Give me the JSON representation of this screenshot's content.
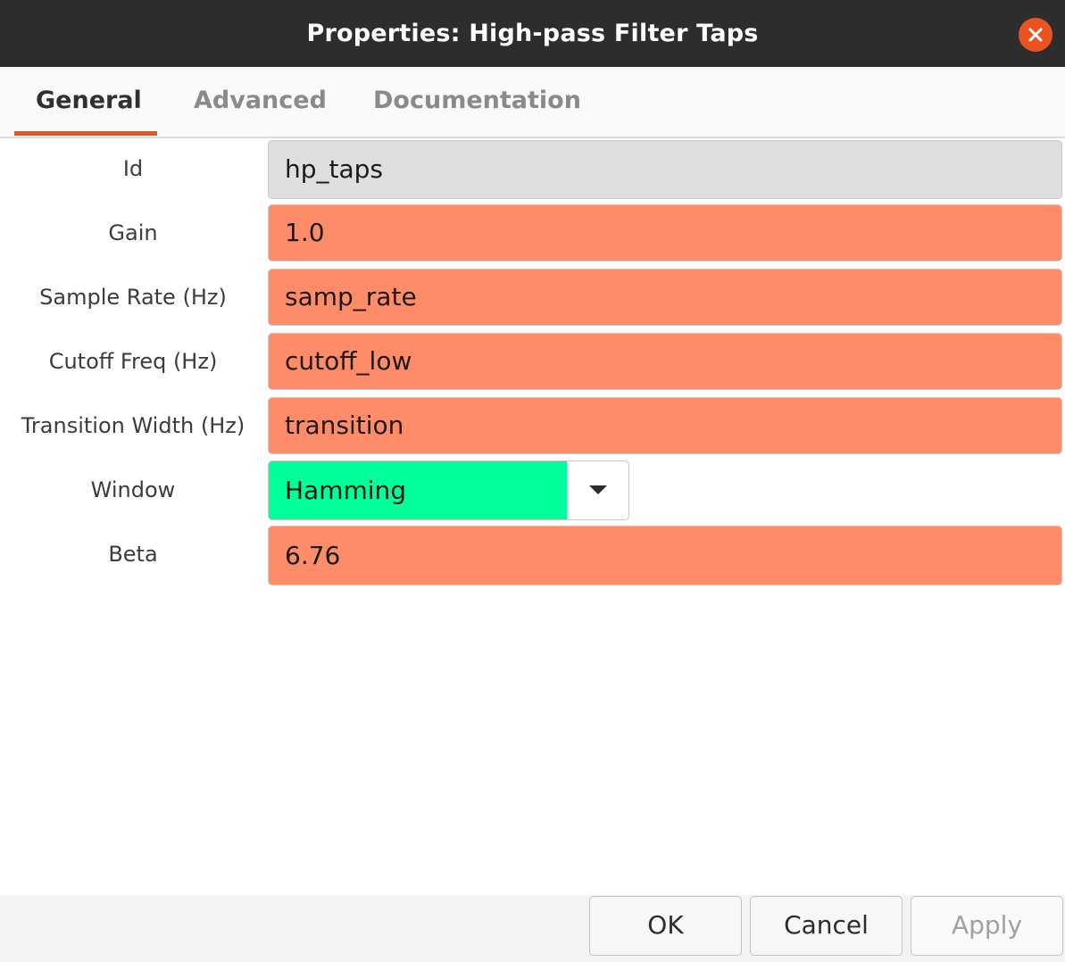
{
  "window": {
    "title": "Properties: High-pass Filter Taps"
  },
  "tabs": [
    {
      "label": "General",
      "active": true
    },
    {
      "label": "Advanced",
      "active": false
    },
    {
      "label": "Documentation",
      "active": false
    }
  ],
  "fields": {
    "id": {
      "label": "Id",
      "value": "hp_taps"
    },
    "gain": {
      "label": "Gain",
      "value": "1.0"
    },
    "sample_rate": {
      "label": "Sample Rate (Hz)",
      "value": "samp_rate"
    },
    "cutoff_freq": {
      "label": "Cutoff Freq (Hz)",
      "value": "cutoff_low"
    },
    "transition_width": {
      "label": "Transition Width (Hz)",
      "value": "transition"
    },
    "window": {
      "label": "Window",
      "value": "Hamming"
    },
    "beta": {
      "label": "Beta",
      "value": "6.76"
    }
  },
  "buttons": {
    "ok": "OK",
    "cancel": "Cancel",
    "apply": "Apply"
  },
  "colors": {
    "accent": "#e95420",
    "field_error": "#ff8c69",
    "field_readonly": "#dedede",
    "field_enum": "#00ff99",
    "titlebar": "#2d2d2d"
  },
  "icons": {
    "close": "close-icon",
    "dropdown": "chevron-down-icon"
  }
}
